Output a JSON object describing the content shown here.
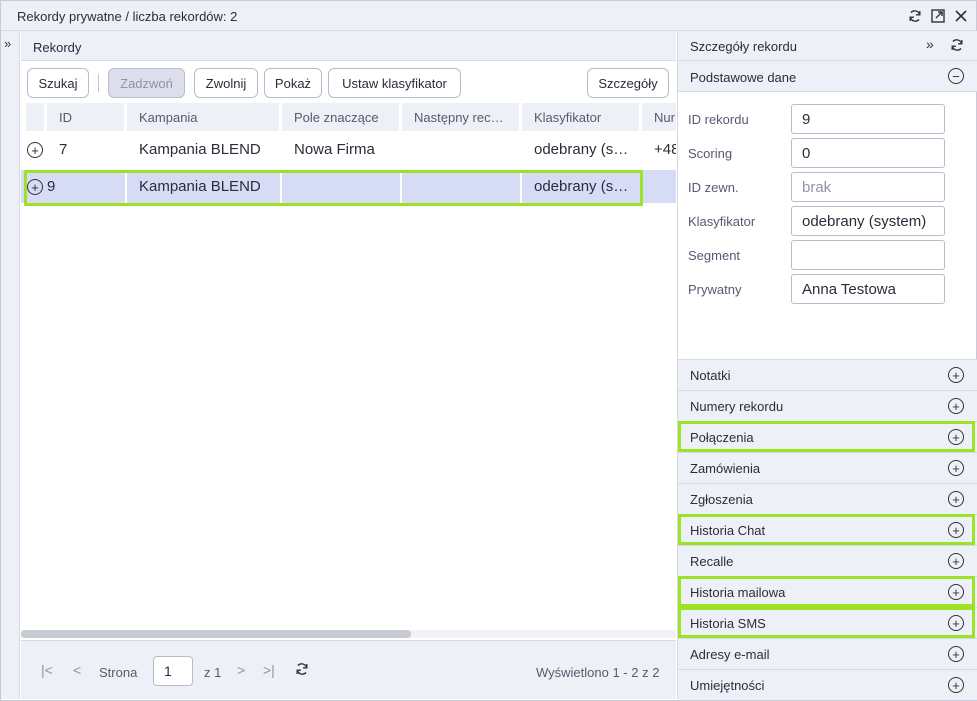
{
  "window": {
    "title": "Rekordy prywatne / liczba rekordów: 2",
    "icons": [
      "refresh-icon",
      "popout-icon",
      "close-icon"
    ]
  },
  "records_panel": {
    "title": "Rekordy",
    "toolbar": {
      "search": "Szukaj",
      "call": "Zadzwoń",
      "release": "Zwolnij",
      "show": "Pokaż",
      "set_classifier": "Ustaw klasyfikator",
      "details": "Szczegóły"
    },
    "columns": [
      "ID",
      "Kampania",
      "Pole znaczące",
      "Następny rec…",
      "Klasyfikator",
      "Nur"
    ],
    "rows": [
      {
        "id": "7",
        "campaign": "Kampania BLEND",
        "field": "Nowa Firma",
        "next": "",
        "classifier": "odebrany (s…",
        "number": "+48"
      },
      {
        "id": "9",
        "campaign": "Kampania BLEND",
        "field": "",
        "next": "",
        "classifier": "odebrany (s…",
        "number": ""
      }
    ],
    "selected_row": 1,
    "pager": {
      "page_label": "Strona",
      "page_value": "1",
      "of_label": "z 1",
      "summary": "Wyświetlono 1 - 2 z 2"
    }
  },
  "details_panel": {
    "title": "Szczegóły rekordu",
    "basic_section": "Podstawowe dane",
    "fields": [
      {
        "label": "ID rekordu",
        "value": "9",
        "placeholder": false
      },
      {
        "label": "Scoring",
        "value": "0",
        "placeholder": false
      },
      {
        "label": "ID zewn.",
        "value": "brak",
        "placeholder": true
      },
      {
        "label": "Klasyfikator",
        "value": "odebrany (system)",
        "placeholder": false
      },
      {
        "label": "Segment",
        "value": "",
        "placeholder": false
      },
      {
        "label": "Prywatny",
        "value": "Anna Testowa",
        "placeholder": false
      }
    ],
    "sections": [
      {
        "label": "Notatki",
        "highlighted": false
      },
      {
        "label": "Numery rekordu",
        "highlighted": false
      },
      {
        "label": "Połączenia",
        "highlighted": true
      },
      {
        "label": "Zamówienia",
        "highlighted": false
      },
      {
        "label": "Zgłoszenia",
        "highlighted": false
      },
      {
        "label": "Historia Chat",
        "highlighted": true
      },
      {
        "label": "Recalle",
        "highlighted": false
      },
      {
        "label": "Historia mailowa",
        "highlighted": true
      },
      {
        "label": "Historia SMS",
        "highlighted": true
      },
      {
        "label": "Adresy e-mail",
        "highlighted": false
      },
      {
        "label": "Umiejętności",
        "highlighted": false
      }
    ]
  },
  "colors": {
    "accent_highlight": "#9be324",
    "selected_row": "#d6dbf6",
    "header_bg": "#eef0f8"
  }
}
